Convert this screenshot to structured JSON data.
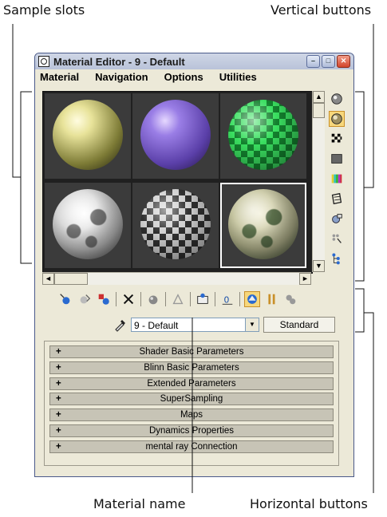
{
  "callouts": {
    "sample_slots": "Sample slots",
    "vertical_buttons": "Vertical buttons",
    "material_name": "Material name",
    "horizontal_buttons": "Horizontal buttons"
  },
  "window": {
    "title": "Material Editor - 9 - Default",
    "minimize": "–",
    "maximize": "□",
    "close": "✕"
  },
  "menu": [
    "Material",
    "Navigation",
    "Options",
    "Utilities"
  ],
  "sample_slots": [
    {
      "name": "yellow-glossy",
      "colors": [
        "#fffce0",
        "#e8e39a",
        "#7c7a35",
        "#1c1c0c"
      ]
    },
    {
      "name": "purple-glossy",
      "colors": [
        "#e6d8ff",
        "#9a7ee6",
        "#5a3fa8",
        "#20133f"
      ]
    },
    {
      "name": "green-checker",
      "colors": [
        "#c8ffd0",
        "#3adf60",
        "#13822e",
        "#062010"
      ]
    },
    {
      "name": "gray-noise",
      "colors": [
        "#ffffff",
        "#c8c8c8",
        "#707070",
        "#151515"
      ]
    },
    {
      "name": "black-white-checker",
      "colors": [
        "#ffffff",
        "#d0d0d0",
        "#303030",
        "#050505"
      ]
    },
    {
      "name": "camo-texture",
      "colors": [
        "#f2efd8",
        "#b8b890",
        "#5a6e4a",
        "#101510"
      ]
    }
  ],
  "scroll": {
    "up": "▲",
    "down": "▼",
    "left": "◄",
    "right": "►"
  },
  "vertical_buttons": [
    {
      "icon": "sample-type-sphere-icon",
      "active": false
    },
    {
      "icon": "backlight-icon",
      "active": true
    },
    {
      "icon": "background-checker-icon",
      "active": false
    },
    {
      "icon": "sample-uv-tiling-icon",
      "active": false
    },
    {
      "icon": "video-color-check-icon",
      "active": false
    },
    {
      "icon": "make-preview-icon",
      "active": false
    },
    {
      "icon": "options-icon",
      "active": false
    },
    {
      "icon": "select-by-material-icon",
      "active": false
    },
    {
      "icon": "material-map-navigator-icon",
      "active": false
    }
  ],
  "horizontal_buttons": [
    {
      "icon": "get-material-icon",
      "active": false
    },
    {
      "icon": "put-to-scene-icon",
      "active": false
    },
    {
      "icon": "assign-to-selection-icon",
      "active": false,
      "sep_after": true
    },
    {
      "icon": "reset-map-icon",
      "active": false,
      "sep_after": true
    },
    {
      "icon": "make-unique-icon",
      "active": false,
      "sep_after": true
    },
    {
      "icon": "put-to-library-icon",
      "active": false,
      "sep_after": true
    },
    {
      "icon": "material-id-channel-icon",
      "active": false,
      "sep_after": true
    },
    {
      "icon": "show-map-in-viewport-icon",
      "active": false,
      "sep_after": true
    },
    {
      "icon": "show-end-result-icon",
      "active": true
    },
    {
      "icon": "go-to-parent-icon",
      "active": false
    },
    {
      "icon": "go-forward-to-sibling-icon",
      "active": false
    }
  ],
  "material": {
    "name": "9 - Default",
    "type": "Standard",
    "dropdown_arrow": "▼"
  },
  "rollouts": [
    {
      "label": "Shader Basic Parameters",
      "sign": "+"
    },
    {
      "label": "Blinn Basic Parameters",
      "sign": "+"
    },
    {
      "label": "Extended Parameters",
      "sign": "+"
    },
    {
      "label": "SuperSampling",
      "sign": "+"
    },
    {
      "label": "Maps",
      "sign": "+"
    },
    {
      "label": "Dynamics Properties",
      "sign": "+"
    },
    {
      "label": "mental ray Connection",
      "sign": "+"
    }
  ]
}
